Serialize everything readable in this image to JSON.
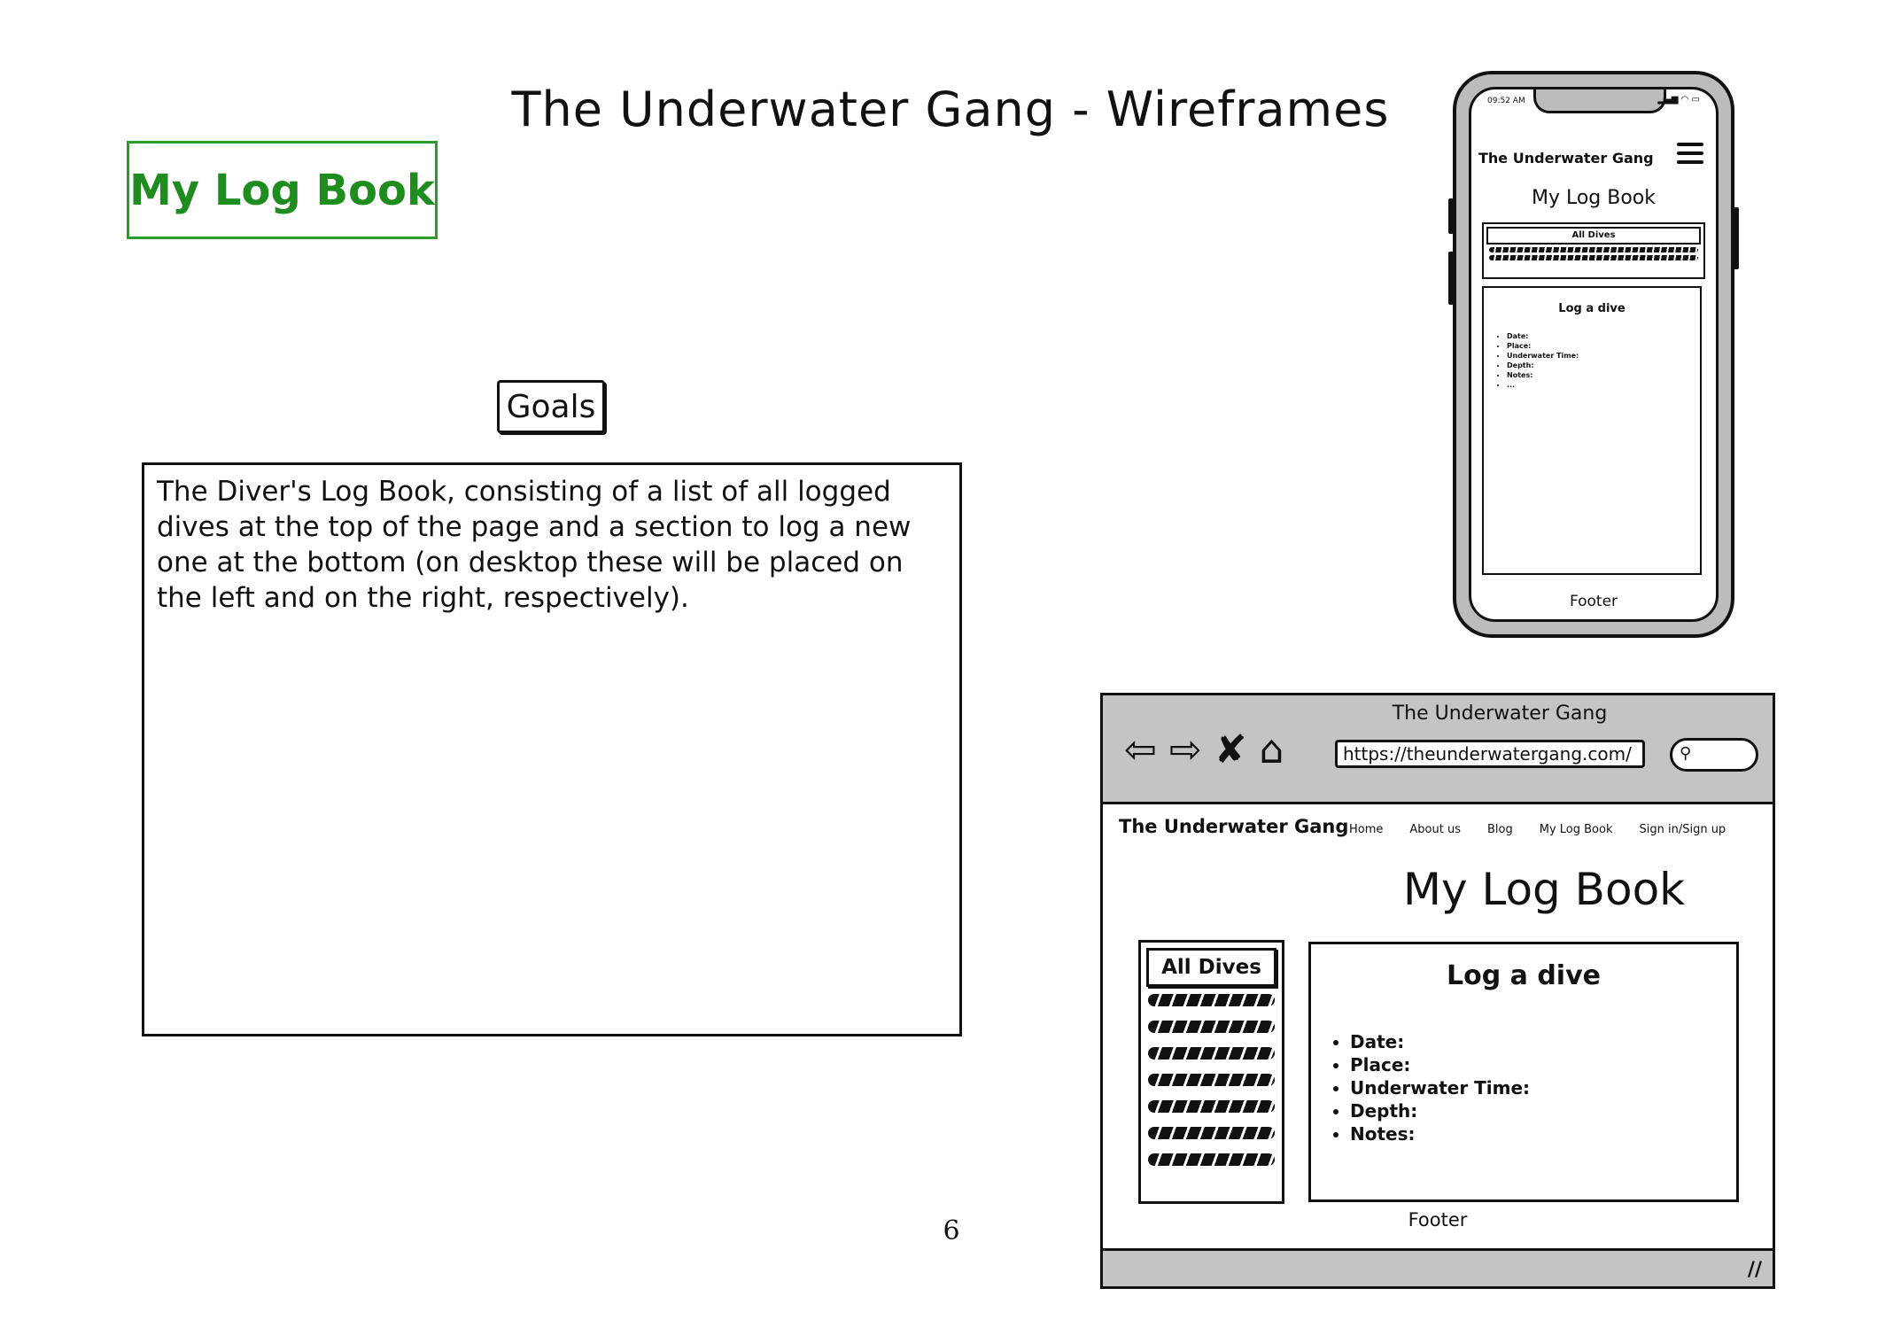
{
  "page": {
    "title": "The Underwater Gang - Wireframes",
    "section_title": "My Log Book",
    "goals_label": "Goals",
    "goals_text": "The Diver's Log Book, consisting of a list of all logged dives at the top of the page and a section to log a new one at the bottom (on desktop these will be placed on the left and on the right, respectively).",
    "page_number": "6"
  },
  "colors": {
    "section_accent": "#1e8c1e",
    "device_frame": "#c4c4c4"
  },
  "mobile": {
    "time": "09:52 AM",
    "brand": "The Underwater Gang",
    "heading": "My Log Book",
    "dives_title": "All Dives",
    "form_title": "Log a dive",
    "form_fields": [
      "Date:",
      "Place:",
      "Underwater Time:",
      "Depth:",
      "Notes:",
      "..."
    ],
    "footer": "Footer"
  },
  "desktop": {
    "window_title": "The Underwater Gang",
    "url": "https://theunderwatergang.com/",
    "brand": "The Underwater Gang",
    "nav": [
      "Home",
      "About us",
      "Blog",
      "My Log Book",
      "Sign in/Sign up"
    ],
    "heading": "My Log Book",
    "dives_title": "All Dives",
    "form_title": "Log a dive",
    "form_fields": [
      "Date:",
      "Place:",
      "Underwater Time:",
      "Depth:",
      "Notes:"
    ],
    "footer": "Footer",
    "icons": [
      "back-arrow-icon",
      "forward-arrow-icon",
      "close-icon",
      "home-icon",
      "search-icon",
      "resize-handle-icon"
    ]
  }
}
